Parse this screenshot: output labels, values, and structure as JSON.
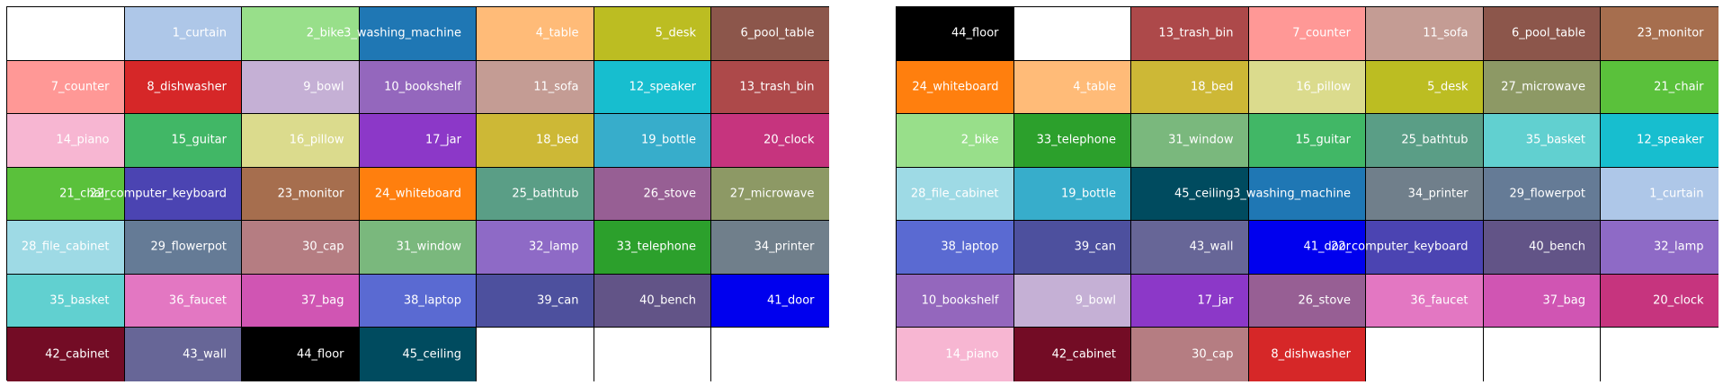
{
  "palette": {
    "1_curtain": "#aec7e8",
    "2_bike": "#98df8a",
    "3_washing_machine": "#1f77b4",
    "4_table": "#ffbb78",
    "5_desk": "#bcbd22",
    "6_pool_table": "#8c564b",
    "7_counter": "#ff9896",
    "8_dishwasher": "#d62728",
    "9_bowl": "#c5b0d5",
    "10_bookshelf": "#9467bd",
    "11_sofa": "#c49c94",
    "12_speaker": "#17becf",
    "13_trash_bin": "#ad494a",
    "14_piano": "#f7b6d2",
    "15_guitar": "#41b766",
    "16_pillow": "#dbdb8d",
    "17_jar": "#8c38c8",
    "18_bed": "#cdb836",
    "19_bottle": "#37adcb",
    "20_clock": "#c6347e",
    "21_chair": "#5ac13b",
    "22_computer_keyboard": "#4b44b2",
    "23_monitor": "#a66e4e",
    "24_whiteboard": "#ff7f0e",
    "25_bathtub": "#5a9e86",
    "26_stove": "#975f94",
    "27_microwave": "#8d9965",
    "28_file_cabinet": "#9edae5",
    "29_flowerpot": "#657b96",
    "30_cap": "#b57d82",
    "31_window": "#7ab87d",
    "32_lamp": "#8e6ac6",
    "33_telephone": "#2ca02c",
    "34_printer": "#707f8b",
    "35_basket": "#61d0d0",
    "36_faucet": "#e377c2",
    "37_bag": "#d055b3",
    "38_laptop": "#5a6ad2",
    "39_can": "#4d509e",
    "40_bench": "#625487",
    "41_door": "#0000ee",
    "42_cabinet": "#730c25",
    "43_wall": "#676697",
    "44_floor": "#000000",
    "45_ceiling": "#004b5f"
  },
  "left_grid": [
    [
      "",
      "1_curtain",
      "2_bike",
      "3_washing_machine",
      "4_table",
      "5_desk",
      "6_pool_table"
    ],
    [
      "7_counter",
      "8_dishwasher",
      "9_bowl",
      "10_bookshelf",
      "11_sofa",
      "12_speaker",
      "13_trash_bin"
    ],
    [
      "14_piano",
      "15_guitar",
      "16_pillow",
      "17_jar",
      "18_bed",
      "19_bottle",
      "20_clock"
    ],
    [
      "21_chair",
      "22_computer_keyboard",
      "23_monitor",
      "24_whiteboard",
      "25_bathtub",
      "26_stove",
      "27_microwave"
    ],
    [
      "28_file_cabinet",
      "29_flowerpot",
      "30_cap",
      "31_window",
      "32_lamp",
      "33_telephone",
      "34_printer"
    ],
    [
      "35_basket",
      "36_faucet",
      "37_bag",
      "38_laptop",
      "39_can",
      "40_bench",
      "41_door"
    ],
    [
      "42_cabinet",
      "43_wall",
      "44_floor",
      "45_ceiling",
      "",
      "",
      ""
    ]
  ],
  "right_grid": [
    [
      "44_floor",
      "",
      "13_trash_bin",
      "7_counter",
      "11_sofa",
      "6_pool_table",
      "23_monitor"
    ],
    [
      "24_whiteboard",
      "4_table",
      "18_bed",
      "16_pillow",
      "5_desk",
      "27_microwave",
      "21_chair"
    ],
    [
      "2_bike",
      "33_telephone",
      "31_window",
      "15_guitar",
      "25_bathtub",
      "35_basket",
      "12_speaker"
    ],
    [
      "28_file_cabinet",
      "19_bottle",
      "45_ceiling",
      "3_washing_machine",
      "34_printer",
      "29_flowerpot",
      "1_curtain"
    ],
    [
      "38_laptop",
      "39_can",
      "43_wall",
      "41_door",
      "22_computer_keyboard",
      "40_bench",
      "32_lamp"
    ],
    [
      "10_bookshelf",
      "9_bowl",
      "17_jar",
      "26_stove",
      "36_faucet",
      "37_bag",
      "20_clock"
    ],
    [
      "14_piano",
      "42_cabinet",
      "30_cap",
      "8_dishwasher",
      "",
      "",
      ""
    ]
  ]
}
